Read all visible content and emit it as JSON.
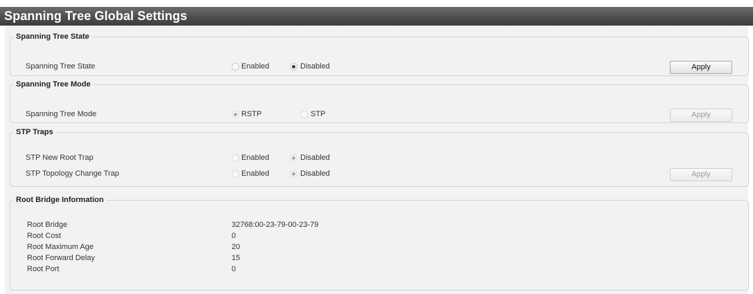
{
  "page": {
    "title": "Spanning Tree Global Settings"
  },
  "sections": {
    "state": {
      "legend": "Spanning Tree State",
      "label": "Spanning Tree State",
      "option_enabled": "Enabled",
      "option_disabled": "Disabled",
      "selected": "Disabled",
      "apply_label": "Apply"
    },
    "mode": {
      "legend": "Spanning Tree Mode",
      "label": "Spanning Tree Mode",
      "option_rstp": "RSTP",
      "option_stp": "STP",
      "selected": "RSTP",
      "apply_label": "Apply"
    },
    "traps": {
      "legend": "STP Traps",
      "rows": [
        {
          "label": "STP New Root Trap",
          "option_enabled": "Enabled",
          "option_disabled": "Disabled",
          "selected": "Disabled"
        },
        {
          "label": "STP Topology Change Trap",
          "option_enabled": "Enabled",
          "option_disabled": "Disabled",
          "selected": "Disabled"
        }
      ],
      "apply_label": "Apply"
    },
    "root": {
      "legend": "Root Bridge Information",
      "rows": [
        {
          "label": "Root Bridge",
          "value": "32768:00-23-79-00-23-79"
        },
        {
          "label": "Root Cost",
          "value": "0"
        },
        {
          "label": "Root Maximum Age",
          "value": "20"
        },
        {
          "label": "Root Forward Delay",
          "value": "15"
        },
        {
          "label": "Root Port",
          "value": "0"
        }
      ]
    }
  }
}
